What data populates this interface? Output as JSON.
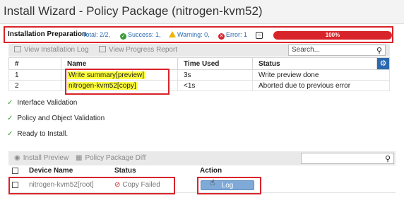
{
  "window": {
    "title": "Install Wizard - Policy Package (nitrogen-kvm52)"
  },
  "prep": {
    "label": "Installation Preparation",
    "total": "Total: 2/2,",
    "success": "Success: 1,",
    "warning": "Warning: 0,",
    "error": "Error: 1",
    "progress_text": "100%",
    "progress_value": 100
  },
  "toolbar1": {
    "view_log": "View Installation Log",
    "view_progress": "View Progress Report",
    "search_placeholder": "Search..."
  },
  "table1": {
    "headers": [
      "#",
      "Name",
      "Time Used",
      "Status"
    ],
    "rows": [
      {
        "num": "1",
        "name": "Write summary[preview]",
        "time": "3s",
        "status": "Write preview done"
      },
      {
        "num": "2",
        "name": "nitrogen-kvm52[copy]",
        "time": "<1s",
        "status": "Aborted due to previous error"
      }
    ]
  },
  "checks": [
    "Interface Validation",
    "Policy and Object Validation",
    "Ready to Install."
  ],
  "toolbar2": {
    "install_preview": "Install Preview",
    "pkg_diff": "Policy Package Diff"
  },
  "table2": {
    "headers": [
      "Device Name",
      "Status",
      "Action"
    ],
    "row": {
      "device": "nitrogen-kvm52[root]",
      "status": "Copy Failed",
      "action": "Log"
    }
  },
  "colors": {
    "error_red": "#d9232a",
    "accent_blue": "#2a69b0",
    "highlight": "#ffff3a"
  }
}
